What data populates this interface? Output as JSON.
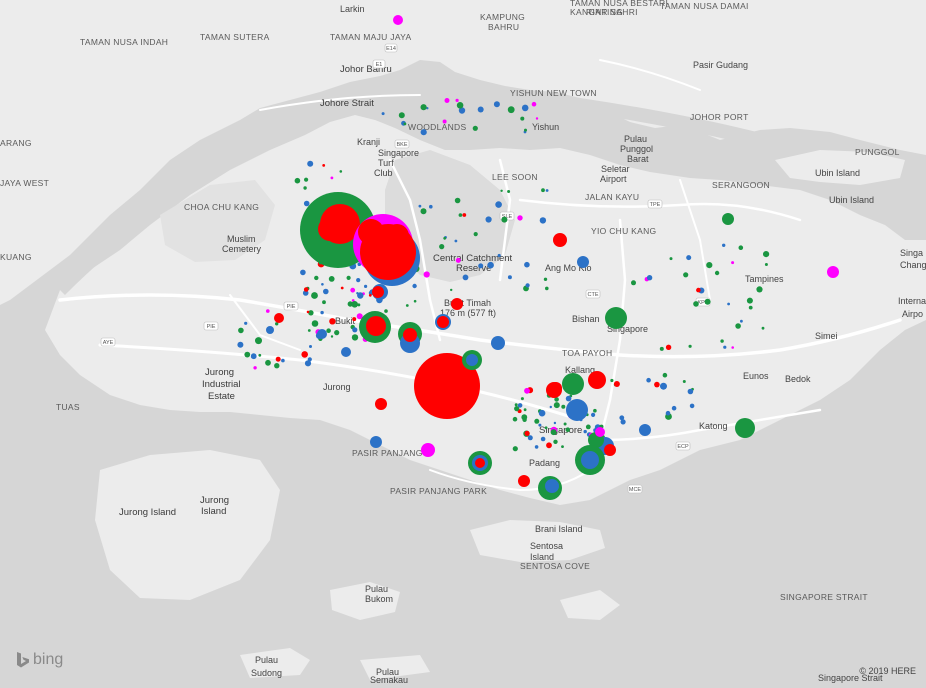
{
  "brand": {
    "name": "bing",
    "icon": "bing-logo-icon"
  },
  "copyright": "© 2019 HERE",
  "colors": {
    "water": "#d6d6d6",
    "land": "#ececec",
    "forest": "#dcdcdc",
    "road": "#ffffff",
    "green": "#1a9641",
    "blue": "#2c72c7",
    "red": "#ff0000",
    "magenta": "#ff00ff"
  },
  "labels": [
    {
      "t": "Larkin",
      "c": "lbl-m"
    },
    {
      "t": "KAMPUNG",
      "c": "lbl"
    },
    {
      "t": "BAHRU",
      "c": "lbl"
    },
    {
      "t": "TAMAN NUSA BESTARI",
      "c": "lbl"
    },
    {
      "t": "TAMAN NUSA DAMAI",
      "c": "lbl"
    },
    {
      "t": "KANGAR SAHRI",
      "c": "lbl"
    },
    {
      "t": "RINTING",
      "c": "lbl"
    },
    {
      "t": "TAMAN NUSA INDAH",
      "c": "lbl"
    },
    {
      "t": "TAMAN SUTERA",
      "c": "lbl"
    },
    {
      "t": "TAMAN MAJU JAYA",
      "c": "lbl"
    },
    {
      "t": "Johor Bahru",
      "c": "lbl-l"
    },
    {
      "t": "Johore Strait",
      "c": "lbl-l"
    },
    {
      "t": "Pasir Gudang",
      "c": "lbl-m"
    },
    {
      "t": "YISHUN NEW TOWN",
      "c": "lbl"
    },
    {
      "t": "JOHOR PORT",
      "c": "lbl"
    },
    {
      "t": "Yishun",
      "c": "lbl-m"
    },
    {
      "t": "WOODLANDS",
      "c": "lbl"
    },
    {
      "t": "Kranji",
      "c": "lbl-m"
    },
    {
      "t": "Pulau",
      "c": "lbl-m"
    },
    {
      "t": "Punggol",
      "c": "lbl-m"
    },
    {
      "t": "Barat",
      "c": "lbl-m"
    },
    {
      "t": "Singapore",
      "c": "lbl-m"
    },
    {
      "t": "Turf",
      "c": "lbl-m"
    },
    {
      "t": "Club",
      "c": "lbl-m"
    },
    {
      "t": "Seletar",
      "c": "lbl-m"
    },
    {
      "t": "Airport",
      "c": "lbl-m"
    },
    {
      "t": "PUNGGOL",
      "c": "lbl"
    },
    {
      "t": "JAYA WEST",
      "c": "lbl"
    },
    {
      "t": "ARANG",
      "c": "lbl"
    },
    {
      "t": "LEE SOON",
      "c": "lbl"
    },
    {
      "t": "JALAN KAYU",
      "c": "lbl"
    },
    {
      "t": "SERANGOON",
      "c": "lbl"
    },
    {
      "t": "CHOA CHU KANG",
      "c": "lbl"
    },
    {
      "t": "Ubin Island",
      "c": "lbl-m"
    },
    {
      "t": "Ubin Island",
      "c": "lbl-m"
    },
    {
      "t": "Muslim",
      "c": "lbl-m"
    },
    {
      "t": "Cemetery",
      "c": "lbl-m"
    },
    {
      "t": "YIO CHU KANG",
      "c": "lbl"
    },
    {
      "t": "Central Catchment",
      "c": "lbl-l"
    },
    {
      "t": "Reserve",
      "c": "lbl-l"
    },
    {
      "t": "Ang Mo Kio",
      "c": "lbl-m"
    },
    {
      "t": "Tampines",
      "c": "lbl-m"
    },
    {
      "t": "KUANG",
      "c": "lbl"
    },
    {
      "t": "Bukit Timah",
      "c": "lbl-m"
    },
    {
      "t": "176 m (577 ft)",
      "c": "lbl-m"
    },
    {
      "t": "Bishan",
      "c": "lbl-m"
    },
    {
      "t": "Singapore",
      "c": "lbl-m"
    },
    {
      "t": "Simei",
      "c": "lbl-m"
    },
    {
      "t": "Bukit",
      "c": "lbl-m"
    },
    {
      "t": "TOA PAYOH",
      "c": "lbl"
    },
    {
      "t": "Jurong",
      "c": "lbl-l"
    },
    {
      "t": "Industrial",
      "c": "lbl-l"
    },
    {
      "t": "Estate",
      "c": "lbl-l"
    },
    {
      "t": "Jurong",
      "c": "lbl-m"
    },
    {
      "t": "Kallang",
      "c": "lbl-m"
    },
    {
      "t": "Eunos",
      "c": "lbl-m"
    },
    {
      "t": "Bedok",
      "c": "lbl-m"
    },
    {
      "t": "TUAS",
      "c": "lbl"
    },
    {
      "t": "Singapore",
      "c": "lbl-l"
    },
    {
      "t": "Katong",
      "c": "lbl-m"
    },
    {
      "t": "PASIR PANJANG",
      "c": "lbl"
    },
    {
      "t": "Padang",
      "c": "lbl-m"
    },
    {
      "t": "Jurong",
      "c": "lbl-l"
    },
    {
      "t": "Island",
      "c": "lbl-l"
    },
    {
      "t": "Jurong Island",
      "c": "lbl-l"
    },
    {
      "t": "PASIR PANJANG PARK",
      "c": "lbl"
    },
    {
      "t": "Brani Island",
      "c": "lbl-m"
    },
    {
      "t": "Sentosa",
      "c": "lbl-m"
    },
    {
      "t": "Island",
      "c": "lbl-m"
    },
    {
      "t": "SENTOSA COVE",
      "c": "lbl"
    },
    {
      "t": "Pulau",
      "c": "lbl-m"
    },
    {
      "t": "Bukom",
      "c": "lbl-m"
    },
    {
      "t": "Pulau",
      "c": "lbl-m"
    },
    {
      "t": "Sudong",
      "c": "lbl-m"
    },
    {
      "t": "Pulau",
      "c": "lbl-m"
    },
    {
      "t": "Semakau",
      "c": "lbl-m"
    },
    {
      "t": "SINGAPORE STRAIT",
      "c": "lbl"
    },
    {
      "t": "Singapore Strait",
      "c": "lbl-m"
    },
    {
      "t": "Singa",
      "c": "lbl-m"
    },
    {
      "t": "Chang",
      "c": "lbl-m"
    },
    {
      "t": "Interna",
      "c": "lbl-m"
    },
    {
      "t": "Airpo",
      "c": "lbl-m"
    }
  ],
  "roads": [
    "PIE",
    "AYE",
    "PIE",
    "BKE",
    "SLE",
    "TPE",
    "CTE",
    "KPE",
    "ECP",
    "MCE",
    "E1",
    "E14"
  ],
  "bubbles": [
    {
      "c": "green",
      "v": 38
    },
    {
      "c": "red",
      "v": 20
    },
    {
      "c": "red",
      "v": 12
    },
    {
      "c": "magenta",
      "v": 30
    },
    {
      "c": "blue",
      "v": 28
    },
    {
      "c": "red",
      "v": 28
    },
    {
      "c": "red",
      "v": 13
    },
    {
      "c": "red",
      "v": 12
    },
    {
      "c": "blue",
      "v": 8
    },
    {
      "c": "red",
      "v": 6
    },
    {
      "c": "red",
      "v": 33
    },
    {
      "c": "green",
      "v": 16
    },
    {
      "c": "red",
      "v": 10
    },
    {
      "c": "green",
      "v": 12
    },
    {
      "c": "blue",
      "v": 10
    },
    {
      "c": "red",
      "v": 7
    },
    {
      "c": "blue",
      "v": 8
    },
    {
      "c": "red",
      "v": 6
    },
    {
      "c": "green",
      "v": 10
    },
    {
      "c": "blue",
      "v": 6
    },
    {
      "c": "red",
      "v": 6
    },
    {
      "c": "red",
      "v": 6
    },
    {
      "c": "green",
      "v": 11
    },
    {
      "c": "red",
      "v": 9
    },
    {
      "c": "red",
      "v": 8
    },
    {
      "c": "blue",
      "v": 11
    },
    {
      "c": "green",
      "v": 11
    },
    {
      "c": "green",
      "v": 10
    },
    {
      "c": "green",
      "v": 12
    },
    {
      "c": "blue",
      "v": 8
    },
    {
      "c": "red",
      "v": 5
    },
    {
      "c": "green",
      "v": 12
    },
    {
      "c": "blue",
      "v": 7
    },
    {
      "c": "blue",
      "v": 9
    },
    {
      "c": "green",
      "v": 8
    },
    {
      "c": "magenta",
      "v": 5
    },
    {
      "c": "red",
      "v": 6
    },
    {
      "c": "green",
      "v": 15
    },
    {
      "c": "blue",
      "v": 9
    },
    {
      "c": "red",
      "v": 7
    },
    {
      "c": "blue",
      "v": 6
    },
    {
      "c": "blue",
      "v": 7
    },
    {
      "c": "magenta",
      "v": 7
    },
    {
      "c": "blue",
      "v": 6
    },
    {
      "c": "red",
      "v": 5
    },
    {
      "c": "magenta",
      "v": 6
    },
    {
      "c": "blue",
      "v": 5
    },
    {
      "c": "red",
      "v": 6
    },
    {
      "c": "blue",
      "v": 4
    },
    {
      "c": "red",
      "v": 6
    },
    {
      "c": "blue",
      "v": 5
    },
    {
      "c": "blue",
      "v": 6
    },
    {
      "c": "green",
      "v": 6
    },
    {
      "c": "magenta",
      "v": 5
    }
  ]
}
